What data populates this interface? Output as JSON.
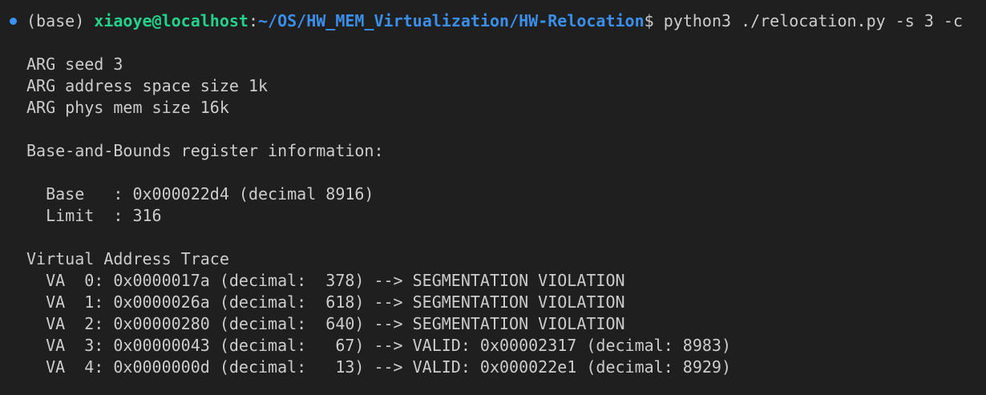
{
  "terminal": {
    "prompt": {
      "env": "(base) ",
      "user_host": "xiaoye@localhost",
      "separator": ":",
      "path": "~/OS/HW_MEM_Virtualization/HW-Relocation",
      "symbol": "$ ",
      "command": "python3 ./relocation.py -s 3 -c"
    },
    "output": [
      "ARG seed 3",
      "ARG address space size 1k",
      "ARG phys mem size 16k",
      "Base-and-Bounds register information:",
      "  Base   : 0x000022d4 (decimal 8916)",
      "  Limit  : 316",
      "Virtual Address Trace",
      "  VA  0: 0x0000017a (decimal:  378) --> SEGMENTATION VIOLATION",
      "  VA  1: 0x0000026a (decimal:  618) --> SEGMENTATION VIOLATION",
      "  VA  2: 0x00000280 (decimal:  640) --> SEGMENTATION VIOLATION",
      "  VA  3: 0x00000043 (decimal:   67) --> VALID: 0x00002317 (decimal: 8983)",
      "  VA  4: 0x0000000d (decimal:   13) --> VALID: 0x000022e1 (decimal: 8929)"
    ]
  },
  "colors": {
    "background": "#1f1f1f",
    "text": "#cccccc",
    "user_host": "#23d18b",
    "path": "#3b8eea",
    "indicator": "#3794ff"
  }
}
